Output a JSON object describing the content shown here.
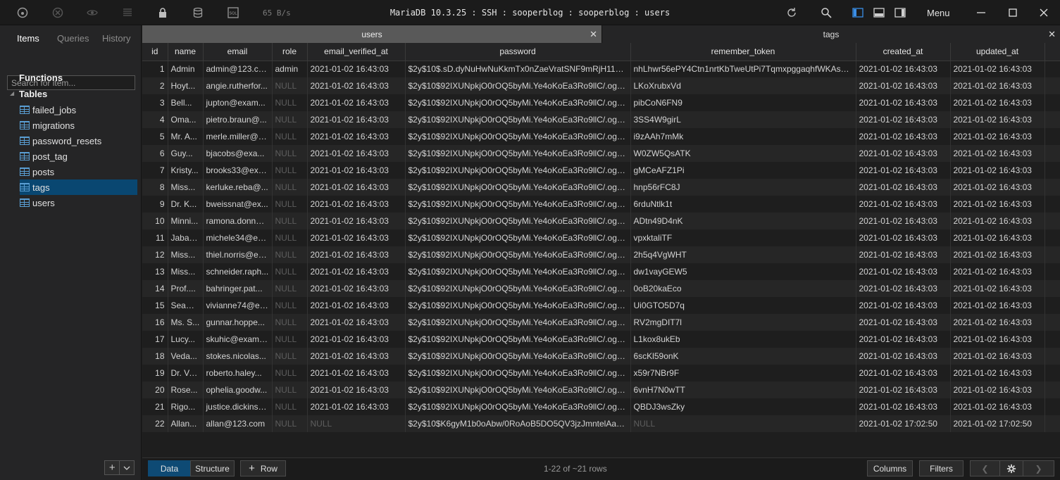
{
  "titlebar": {
    "speed": "65 B/s",
    "title": "MariaDB 10.3.25 : SSH : sooperblog : sooperblog : users",
    "menu_label": "Menu"
  },
  "sidebar": {
    "tabs": [
      "Items",
      "Queries",
      "History"
    ],
    "search_placeholder": "Search for item...",
    "functions_label": "Functions",
    "tables_label": "Tables",
    "tables": [
      "failed_jobs",
      "migrations",
      "password_resets",
      "post_tag",
      "posts",
      "tags",
      "users"
    ],
    "selected": "tags"
  },
  "doc_tabs": [
    {
      "label": "users",
      "active": true
    },
    {
      "label": "tags",
      "active": false
    }
  ],
  "columns": [
    "id",
    "name",
    "email",
    "role",
    "email_verified_at",
    "password",
    "remember_token",
    "created_at",
    "updated_at"
  ],
  "rows": [
    [
      "1",
      "Admin",
      "admin@123.co...",
      "admin",
      "2021-01-02 16:43:03",
      "$2y$10$.sD.dyNuHwNuKkmTx0nZaeVratSNF9mRjH11U6...",
      "nhLhwr56ePY4Ctn1nrtKbTweUtPi7TqmxpggaqhfWKAsQjT...",
      "2021-01-02 16:43:03",
      "2021-01-02 16:43:03"
    ],
    [
      "2",
      "Hoyt...",
      "angie.rutherfor...",
      "NULL",
      "2021-01-02 16:43:03",
      "$2y$10$92IXUNpkjO0rOQ5byMi.Ye4oKoEa3Ro9llC/.og/at...",
      "LKoXrubxVd",
      "2021-01-02 16:43:03",
      "2021-01-02 16:43:03"
    ],
    [
      "3",
      "Bell...",
      "jupton@exam...",
      "NULL",
      "2021-01-02 16:43:03",
      "$2y$10$92IXUNpkjO0rOQ5byMi.Ye4oKoEa3Ro9llC/.og/at...",
      "pibCoN6FN9",
      "2021-01-02 16:43:03",
      "2021-01-02 16:43:03"
    ],
    [
      "4",
      "Oma...",
      "pietro.braun@...",
      "NULL",
      "2021-01-02 16:43:03",
      "$2y$10$92IXUNpkjO0rOQ5byMi.Ye4oKoEa3Ro9llC/.og/at...",
      "3SS4W9girL",
      "2021-01-02 16:43:03",
      "2021-01-02 16:43:03"
    ],
    [
      "5",
      "Mr. A...",
      "merle.miller@e...",
      "NULL",
      "2021-01-02 16:43:03",
      "$2y$10$92IXUNpkjO0rOQ5byMi.Ye4oKoEa3Ro9llC/.og/at...",
      "i9zAAh7mMk",
      "2021-01-02 16:43:03",
      "2021-01-02 16:43:03"
    ],
    [
      "6",
      "Guy...",
      "bjacobs@exa...",
      "NULL",
      "2021-01-02 16:43:03",
      "$2y$10$92IXUNpkjO0rOQ5byMi.Ye4oKoEa3Ro9llC/.og/at...",
      "W0ZW5QsATK",
      "2021-01-02 16:43:03",
      "2021-01-02 16:43:03"
    ],
    [
      "7",
      "Kristy...",
      "brooks33@exa...",
      "NULL",
      "2021-01-02 16:43:03",
      "$2y$10$92IXUNpkjO0rOQ5byMi.Ye4oKoEa3Ro9llC/.og/at...",
      "gMCeAFZ1Pi",
      "2021-01-02 16:43:03",
      "2021-01-02 16:43:03"
    ],
    [
      "8",
      "Miss...",
      "kerluke.reba@...",
      "NULL",
      "2021-01-02 16:43:03",
      "$2y$10$92IXUNpkjO0rOQ5byMi.Ye4oKoEa3Ro9llC/.og/at...",
      "hnp56rFC8J",
      "2021-01-02 16:43:03",
      "2021-01-02 16:43:03"
    ],
    [
      "9",
      "Dr. K...",
      "bweissnat@ex...",
      "NULL",
      "2021-01-02 16:43:03",
      "$2y$10$92IXUNpkjO0rOQ5byMi.Ye4oKoEa3Ro9llC/.og/at...",
      "6rduNtlk1t",
      "2021-01-02 16:43:03",
      "2021-01-02 16:43:03"
    ],
    [
      "10",
      "Minni...",
      "ramona.donnel...",
      "NULL",
      "2021-01-02 16:43:03",
      "$2y$10$92IXUNpkjO0rOQ5byMi.Ye4oKoEa3Ro9llC/.og/at...",
      "ADtn49D4nK",
      "2021-01-02 16:43:03",
      "2021-01-02 16:43:03"
    ],
    [
      "11",
      "Jabari...",
      "michele34@ex...",
      "NULL",
      "2021-01-02 16:43:03",
      "$2y$10$92IXUNpkjO0rOQ5byMi.Ye4oKoEa3Ro9llC/.og/at...",
      "vpxktaliTF",
      "2021-01-02 16:43:03",
      "2021-01-02 16:43:03"
    ],
    [
      "12",
      "Miss...",
      "thiel.norris@ex...",
      "NULL",
      "2021-01-02 16:43:03",
      "$2y$10$92IXUNpkjO0rOQ5byMi.Ye4oKoEa3Ro9llC/.og/at...",
      "2h5q4VgWHT",
      "2021-01-02 16:43:03",
      "2021-01-02 16:43:03"
    ],
    [
      "13",
      "Miss...",
      "schneider.raph...",
      "NULL",
      "2021-01-02 16:43:03",
      "$2y$10$92IXUNpkjO0rOQ5byMi.Ye4oKoEa3Ro9llC/.og/at...",
      "dw1vayGEW5",
      "2021-01-02 16:43:03",
      "2021-01-02 16:43:03"
    ],
    [
      "14",
      "Prof....",
      "bahringer.pat...",
      "NULL",
      "2021-01-02 16:43:03",
      "$2y$10$92IXUNpkjO0rOQ5byMi.Ye4oKoEa3Ro9llC/.og/at...",
      "0oB20kaEco",
      "2021-01-02 16:43:03",
      "2021-01-02 16:43:03"
    ],
    [
      "15",
      "Seam...",
      "vivianne74@ex...",
      "NULL",
      "2021-01-02 16:43:03",
      "$2y$10$92IXUNpkjO0rOQ5byMi.Ye4oKoEa3Ro9llC/.og/at...",
      "Ui0GTO5D7q",
      "2021-01-02 16:43:03",
      "2021-01-02 16:43:03"
    ],
    [
      "16",
      "Ms. S...",
      "gunnar.hoppe...",
      "NULL",
      "2021-01-02 16:43:03",
      "$2y$10$92IXUNpkjO0rOQ5byMi.Ye4oKoEa3Ro9llC/.og/at...",
      "RV2mgDIT7l",
      "2021-01-02 16:43:03",
      "2021-01-02 16:43:03"
    ],
    [
      "17",
      "Lucy...",
      "skuhic@examp...",
      "NULL",
      "2021-01-02 16:43:03",
      "$2y$10$92IXUNpkjO0rOQ5byMi.Ye4oKoEa3Ro9llC/.og/at...",
      "L1kox8ukEb",
      "2021-01-02 16:43:03",
      "2021-01-02 16:43:03"
    ],
    [
      "18",
      "Veda...",
      "stokes.nicolas...",
      "NULL",
      "2021-01-02 16:43:03",
      "$2y$10$92IXUNpkjO0rOQ5byMi.Ye4oKoEa3Ro9llC/.og/at...",
      "6scKl59onK",
      "2021-01-02 16:43:03",
      "2021-01-02 16:43:03"
    ],
    [
      "19",
      "Dr. Va...",
      "roberto.haley...",
      "NULL",
      "2021-01-02 16:43:03",
      "$2y$10$92IXUNpkjO0rOQ5byMi.Ye4oKoEa3Ro9llC/.og/at...",
      "x59r7NBr9F",
      "2021-01-02 16:43:03",
      "2021-01-02 16:43:03"
    ],
    [
      "20",
      "Rose...",
      "ophelia.goodw...",
      "NULL",
      "2021-01-02 16:43:03",
      "$2y$10$92IXUNpkjO0rOQ5byMi.Ye4oKoEa3Ro9llC/.og/at...",
      "6vnH7N0wTT",
      "2021-01-02 16:43:03",
      "2021-01-02 16:43:03"
    ],
    [
      "21",
      "Rigo...",
      "justice.dickinso...",
      "NULL",
      "2021-01-02 16:43:03",
      "$2y$10$92IXUNpkjO0rOQ5byMi.Ye4oKoEa3Ro9llC/.og/at...",
      "QBDJ3wsZky",
      "2021-01-02 16:43:03",
      "2021-01-02 16:43:03"
    ],
    [
      "22",
      "Allan...",
      "allan@123.com",
      "NULL",
      "NULL",
      "$2y$10$K6gyM1b0oAbw/0RoAoB5DO5QV3jzJmntelAaP...",
      "NULL",
      "2021-01-02 17:02:50",
      "2021-01-02 17:02:50"
    ]
  ],
  "bottom": {
    "data_label": "Data",
    "structure_label": "Structure",
    "row_label": "Row",
    "rows_info": "1-22 of ~21 rows",
    "columns_label": "Columns",
    "filters_label": "Filters"
  }
}
